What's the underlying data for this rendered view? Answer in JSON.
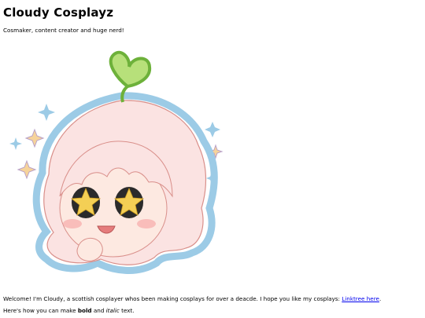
{
  "header": {
    "title": "Cloudy Cosplayz",
    "tagline": "Cosmaker, content creator and huge nerd!"
  },
  "avatar": {
    "icon": "chibi-avatar-illustration",
    "colors": {
      "outline": "#9ccbe6",
      "sprout": "#8fd147",
      "hair": "#fbe3e2",
      "skin": "#fde9e1",
      "star_eyes": "#f4cf55",
      "sparkle": "#9ccbe6"
    }
  },
  "content": {
    "welcome_prefix": "Welcome! I'm Cloudy, a scottish cosplayer whos been making cosplays for over a deacde. I hope you like my cosplays: ",
    "link_text": "Linktree here",
    "welcome_suffix": ".",
    "formatting_prefix": "Here's how you can make ",
    "bold_word": "bold",
    "formatting_middle": " and ",
    "italic_word": "italic",
    "formatting_suffix": " text."
  }
}
